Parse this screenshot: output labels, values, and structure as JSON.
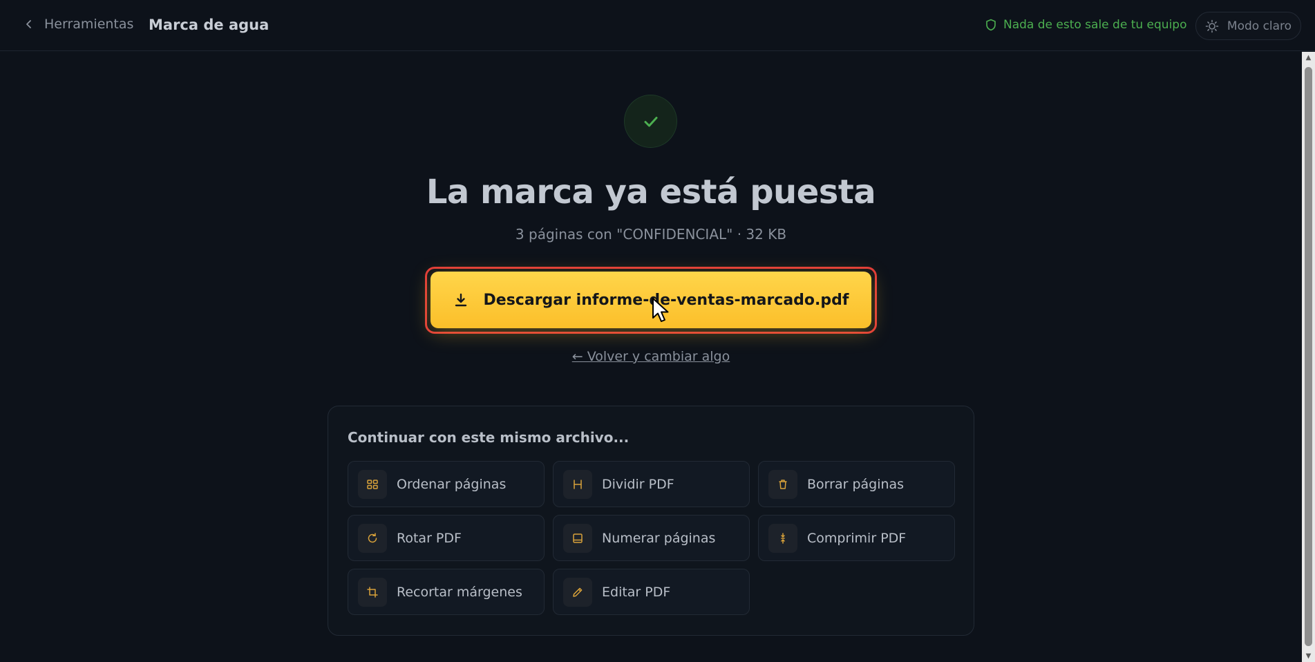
{
  "header": {
    "back_label": "Herramientas",
    "title": "Marca de agua",
    "privacy_note": "Nada de esto sale de tu equipo",
    "theme_toggle_label": "Modo claro"
  },
  "result": {
    "headline": "La marca ya está puesta",
    "summary": "3 páginas con \"CONFIDENCIAL\" · 32 KB",
    "download_label": "Descargar informe-de-ventas-marcado.pdf",
    "back_change_label": "← Volver y cambiar algo"
  },
  "continue": {
    "title": "Continuar con este mismo archivo...",
    "tools": [
      {
        "label": "Ordenar páginas",
        "icon": "grid-icon"
      },
      {
        "label": "Dividir PDF",
        "icon": "split-icon"
      },
      {
        "label": "Borrar páginas",
        "icon": "trash-icon"
      },
      {
        "label": "Rotar PDF",
        "icon": "rotate-icon"
      },
      {
        "label": "Numerar páginas",
        "icon": "page-number-icon"
      },
      {
        "label": "Comprimir PDF",
        "icon": "compress-icon"
      },
      {
        "label": "Recortar márgenes",
        "icon": "crop-icon"
      },
      {
        "label": "Editar PDF",
        "icon": "pencil-icon"
      }
    ]
  },
  "colors": {
    "background": "#0d121a",
    "accent": "#fbbf2a",
    "success": "#4caf50",
    "highlight_outline": "#e03a3a"
  }
}
